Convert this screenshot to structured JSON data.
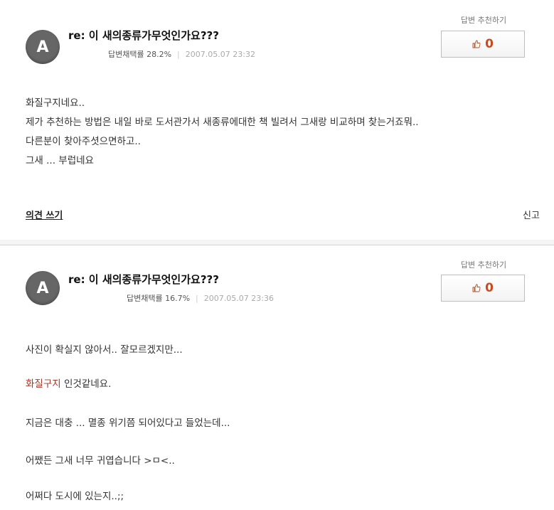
{
  "answers": [
    {
      "avatar_letter": "A",
      "title": "re: 이 새의종류가무엇인가요???",
      "adoption_rate": "답변채택률 28.2%",
      "date": "2007.05.07 23:32",
      "recommend_label": "답변 추천하기",
      "recommend_count": "0",
      "body": [
        "화질구지네요..",
        "제가 추천하는 방법은 내일 바로 도서관가서 새종류에대한 책 빌려서 그새랑 비교하며 찾는거죠뭐..",
        "다른분이 찾아주셧으면하고..",
        "그새 ... 부럽네요"
      ],
      "opinion_label": "의견 쓰기",
      "report_label": "신고"
    },
    {
      "avatar_letter": "A",
      "title": "re: 이 새의종류가무엇인가요???",
      "adoption_rate": "답변채택률 16.7%",
      "date": "2007.05.07 23:36",
      "recommend_label": "답변 추천하기",
      "recommend_count": "0",
      "body": [
        "사진이 확실지 않아서.. 잘모르겠지만...",
        "화질구지",
        " 인것같네요.",
        "지금은 대충 ... 멸종 위기쯤 되어있다고 들었는데...",
        "어쨌든 그새 너무 귀엽습니다 >ㅁ<..",
        "어쩌다 도시에 있는지..;;"
      ]
    }
  ],
  "colors": {
    "accent": "#c84a1e",
    "highlight": "#a23a2a",
    "avatar_bg": "#666666"
  },
  "icons": {
    "recommend": "thumbs-up-icon"
  }
}
